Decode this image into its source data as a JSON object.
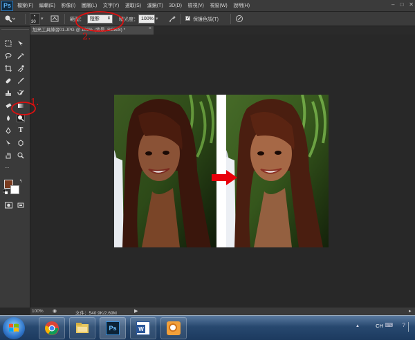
{
  "app": {
    "logo": "Ps",
    "menu": [
      "檔案(F)",
      "編輯(E)",
      "影像(I)",
      "圖層(L)",
      "文字(Y)",
      "選取(S)",
      "濾鏡(T)",
      "3D(D)",
      "檢視(V)",
      "視窗(W)",
      "說明(H)"
    ]
  },
  "options": {
    "brush_size": "30",
    "range_label": "範圍：",
    "range_value": "陰影",
    "exposure_label": "曝光度：",
    "exposure_value": "100%",
    "protect_tones_label": "保護色調(T)",
    "protect_tones_checked": true
  },
  "document": {
    "tab_title": "加亮工具練習01.JPG @ 100% (背景, RGB/8) *",
    "tab_close": "×"
  },
  "status": {
    "zoom": "100%",
    "file_info": "文件：540.9K/2.69M"
  },
  "annotations": {
    "step1": "1.",
    "step2": "2."
  },
  "colors": {
    "foreground": "#7a3b1f",
    "background": "#ffffff",
    "annotation": "#e01010",
    "arrow": "#e8000a"
  },
  "taskbar": {
    "apps": [
      "chrome-icon",
      "explorer-icon",
      "photoshop-icon",
      "word-icon",
      "outlook-icon"
    ],
    "tray_lang": "CH"
  }
}
